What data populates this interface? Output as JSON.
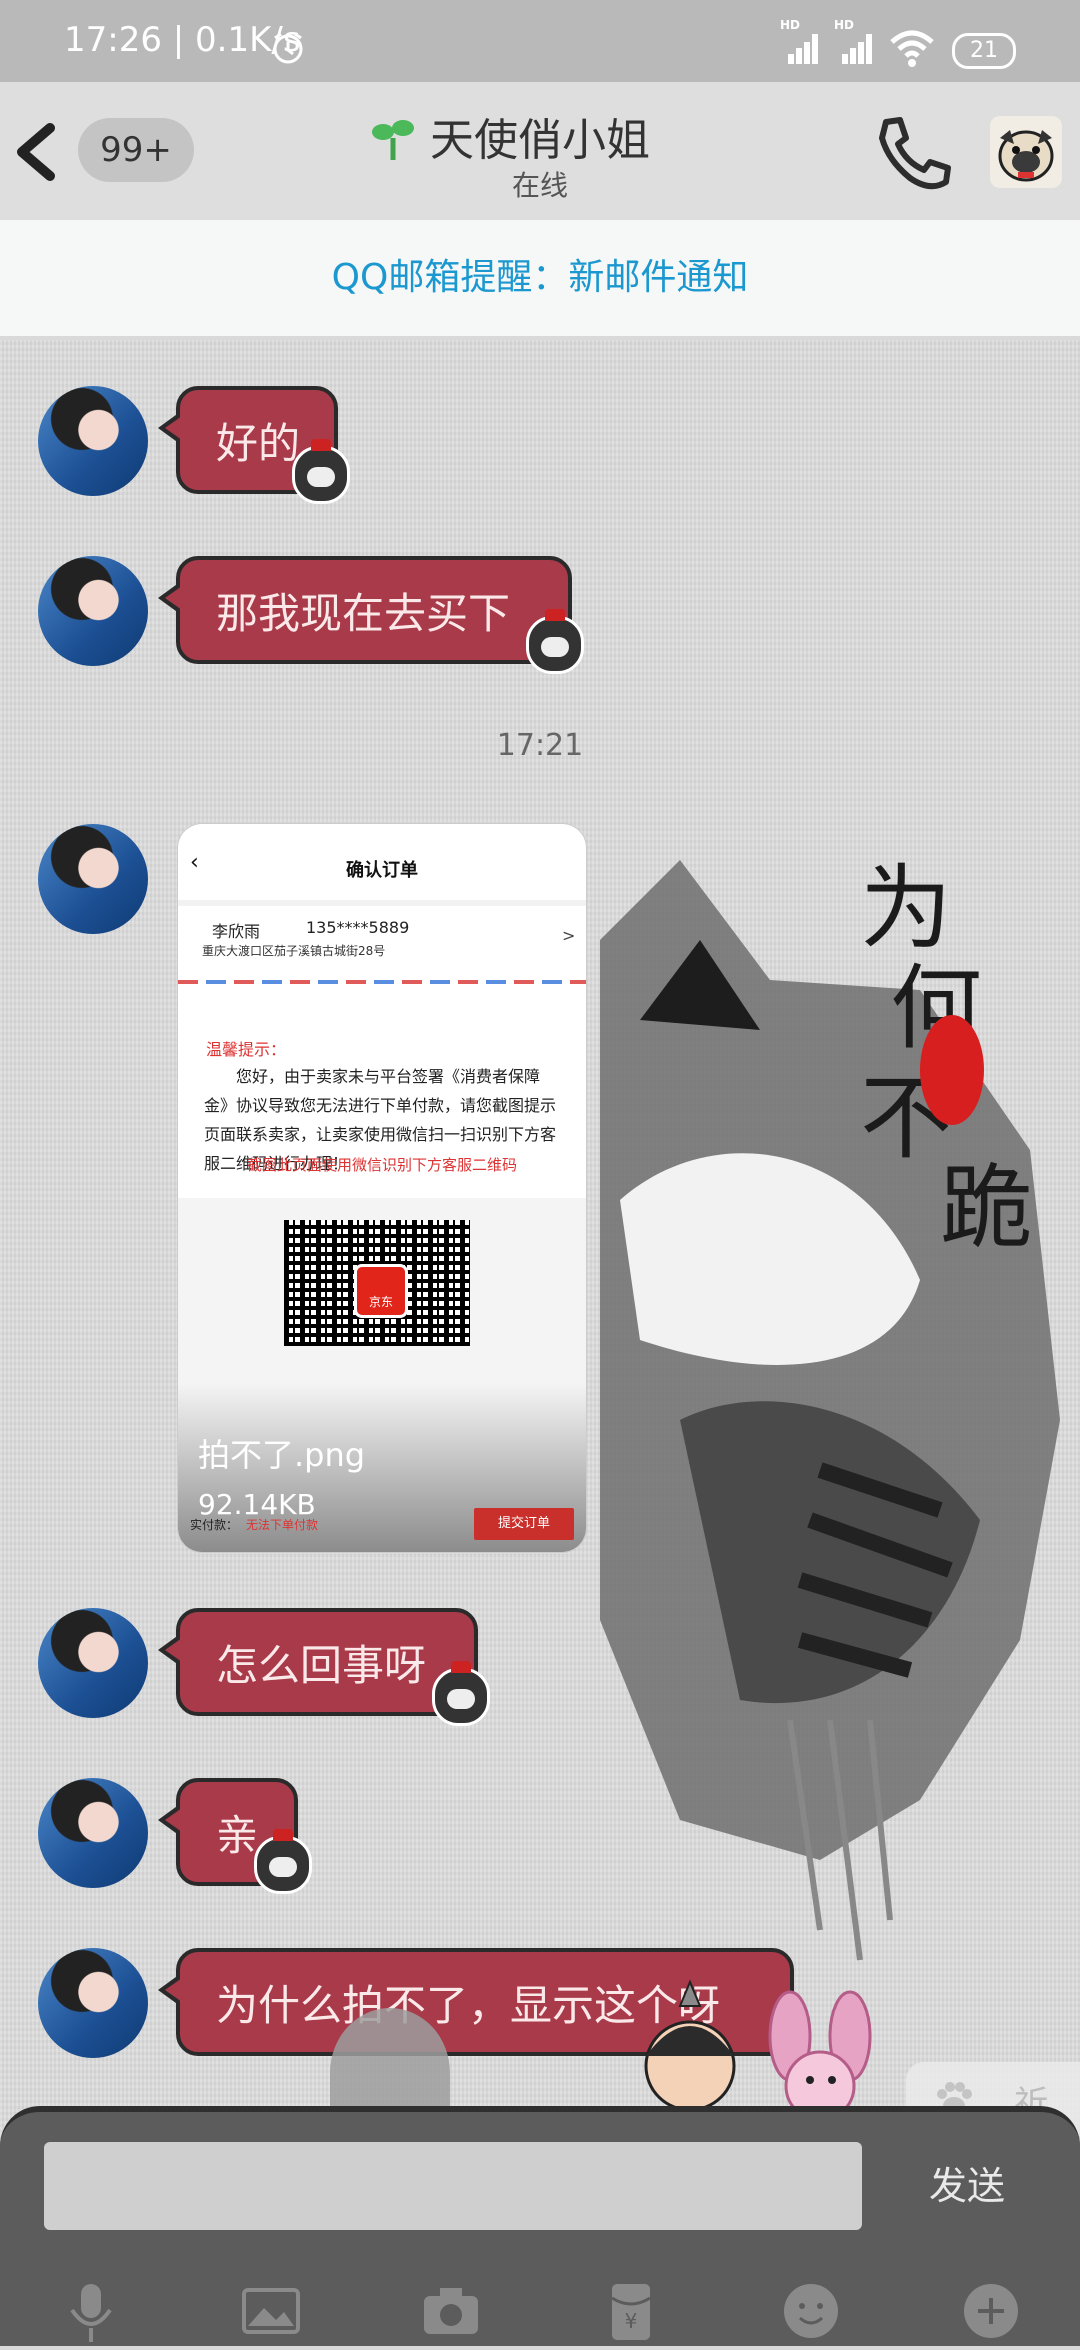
{
  "status_bar": {
    "time_speed": "17:26 | 0.1K/s",
    "hd1": "HD",
    "hd2": "HD",
    "battery": "21"
  },
  "header": {
    "unread_count": "99+",
    "contact_name": "天使俏小姐",
    "contact_status": "在线"
  },
  "mail_notice": "QQ邮箱提醒：新邮件通知",
  "messages": [
    {
      "text": "好的"
    },
    {
      "text": "那我现在去买下"
    },
    {
      "text": "怎么回事呀"
    },
    {
      "text": "亲"
    },
    {
      "text": "为什么拍不了，显示这个呀"
    }
  ],
  "timestamp": "17:21",
  "image_message": {
    "title": "确认订单",
    "name": "李欣雨",
    "phone": "135****5889",
    "address": "重庆大渡口区茄子溪镇古城街28号",
    "warn_title": "温馨提示：",
    "warn_text": "您好，由于卖家未与平台签署《消费者保障金》协议导致您无法进行下单付款，请您截图提示页面联系卖家，让卖家使用微信扫一扫识别下方客服二维码进行办理！",
    "warn_red": "截图此页面使用微信识别下方客服二维码",
    "qr_logo": "京东",
    "file_name": "拍不了.png",
    "file_size": "92.14KB",
    "footer_label": "实付款：",
    "footer_red": "无法下单付款",
    "submit": "提交订单"
  },
  "sticker_bar": {
    "text": "祈福"
  },
  "input": {
    "send_label": "发送"
  },
  "toolbar": [
    "voice-icon",
    "image-icon",
    "camera-icon",
    "red-packet-icon",
    "emoji-icon",
    "plus-icon"
  ],
  "colors": {
    "bubble": "#a83a4a",
    "mail_notice_text": "#1a98cf",
    "submit": "#c9302c"
  }
}
